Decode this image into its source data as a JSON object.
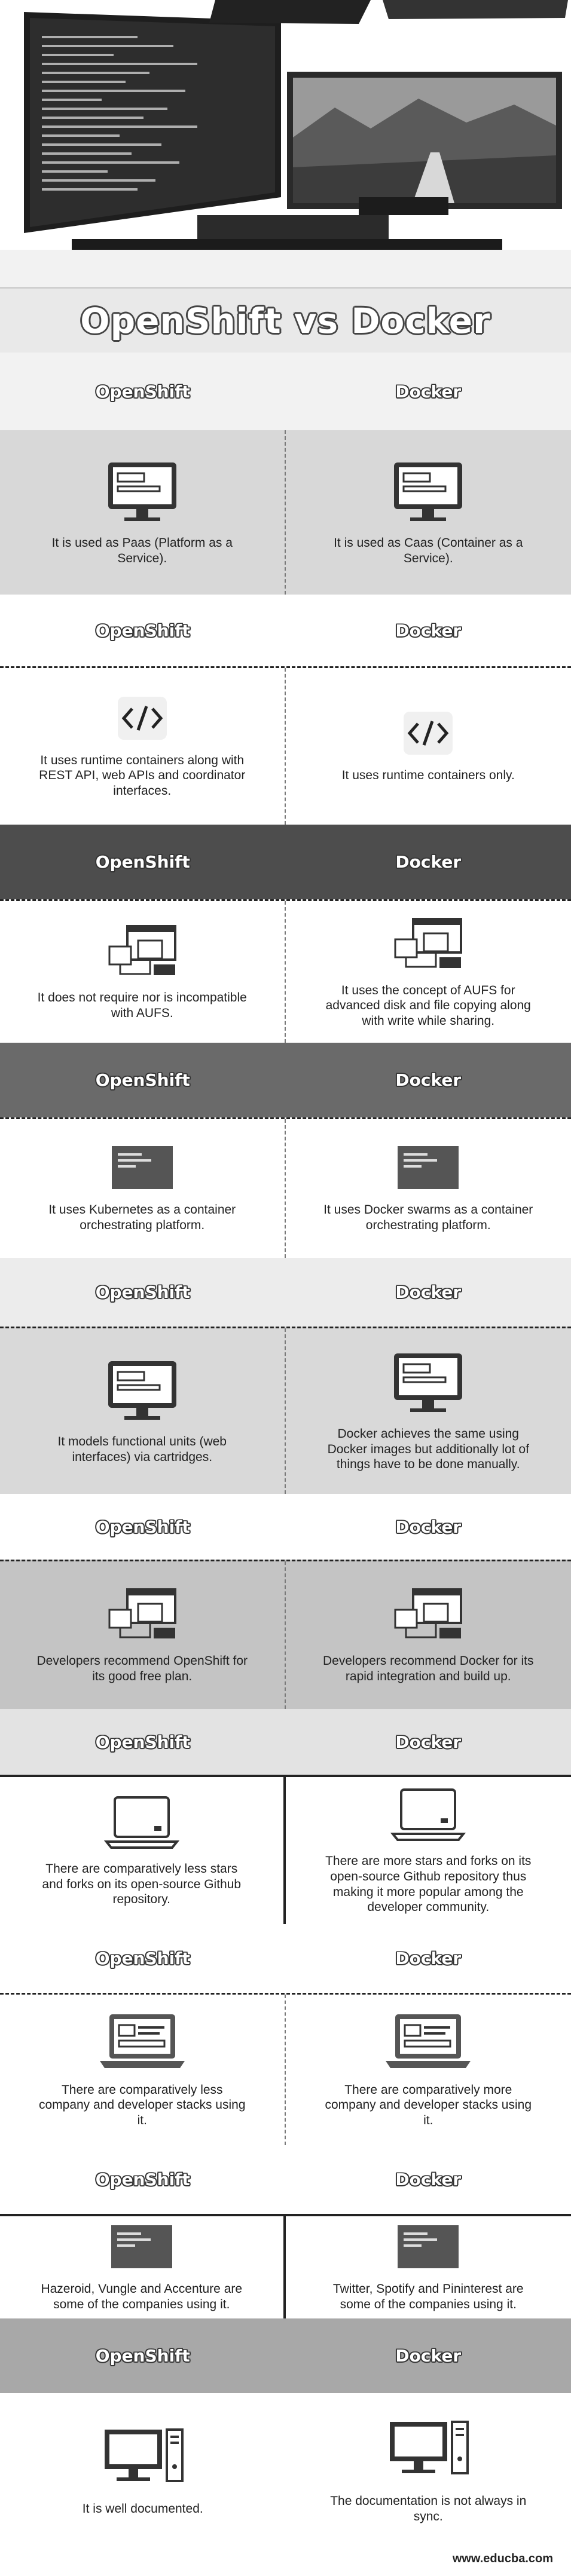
{
  "title": "OpenShift vs Docker",
  "header": {
    "left": "OpenShift",
    "right": "Docker"
  },
  "rows": [
    {
      "left": "It is used as Paas (Platform as a Service).",
      "right": "It is used as Caas (Container as a Service).",
      "icon": "monitor-icon"
    },
    {
      "left": "It uses runtime containers along with REST API, web APIs and coordinator interfaces.",
      "right": "It uses runtime containers only.",
      "icon": "code-icon"
    },
    {
      "left": "It does not require nor is incompatible with AUFS.",
      "right": "It uses the concept of AUFS for advanced disk and file copying along with write while sharing.",
      "icon": "network-icon"
    },
    {
      "left": "It uses Kubernetes as a container orchestrating platform.",
      "right": "It uses Docker swarms as a container orchestrating platform.",
      "icon": "screen-icon"
    },
    {
      "left": "It models functional units (web interfaces) via cartridges.",
      "right": "Docker achieves the same using Docker images but additionally lot of things have to be done manually.",
      "icon": "monitor-icon"
    },
    {
      "left": "Developers recommend OpenShift for its good free plan.",
      "right": "Developers recommend Docker for its rapid integration and build up.",
      "icon": "network-icon"
    },
    {
      "left": "There are comparatively less stars and forks on its open-source Github repository.",
      "right": "There are more stars and forks on its open-source Github repository thus making it more popular among the developer community.",
      "icon": "laptop-icon"
    },
    {
      "left": "There are comparatively less company and developer stacks using it.",
      "right": "There are comparatively more company and developer stacks using it.",
      "icon": "laptop-window-icon"
    },
    {
      "left": "Hazeroid, Vungle and Accenture are some of the companies using it.",
      "right": "Twitter, Spotify and Pininterest are some of the companies using it.",
      "icon": "screen-icon"
    },
    {
      "left": "It is well documented.",
      "right": "The documentation is not always in sync.",
      "icon": "desktop-tower-icon"
    }
  ],
  "footer": "www.educba.com"
}
